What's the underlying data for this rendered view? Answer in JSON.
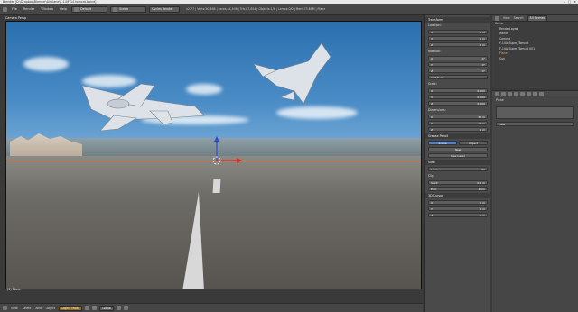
{
  "window": {
    "title": "Blender [D:\\Dropbox\\Blender\\Airplane\\F-14\\F-14 tomcat.blend]",
    "controls": [
      "–",
      "□",
      "×"
    ]
  },
  "infobar": {
    "menus": [
      "File",
      "Render",
      "Window",
      "Help"
    ],
    "layout": "Default",
    "scene": "Scene",
    "engine": "Cycles Render",
    "stats": "v2.77 | Verts:50,466 | Faces:44,946 | Tris:87,854 | Objects:1/6 | Lamps:0/0 | Mem:73.84M | Plane"
  },
  "viewport": {
    "header": "Camera Persp",
    "object": "(1) Plane",
    "colors": {
      "sky": "#4a8cc6",
      "horizon_line": "#c45a1e"
    }
  },
  "toolbar": {
    "menus": [
      "View",
      "Select",
      "Add",
      "Object"
    ],
    "mode": "Object Mode",
    "pivot": "Global"
  },
  "npanel": {
    "sections": [
      {
        "title": "Transform",
        "fields": []
      },
      {
        "title": "Location:",
        "fields": [
          [
            "X:",
            "0 m"
          ],
          [
            "Y:",
            "0 m"
          ],
          [
            "Z:",
            "0 m"
          ]
        ]
      },
      {
        "title": "Rotation:",
        "fields": [
          [
            "X:",
            "0°"
          ],
          [
            "Y:",
            "0°"
          ],
          [
            "Z:",
            "0°"
          ]
        ]
      },
      {
        "title": "XYZ Euler",
        "fields": []
      },
      {
        "title": "Scale:",
        "fields": [
          [
            "X:",
            "0.000"
          ],
          [
            "Y:",
            "0.000"
          ],
          [
            "Z:",
            "0.000"
          ]
        ]
      },
      {
        "title": "Dimensions:",
        "fields": [
          [
            "X:",
            "30 m"
          ],
          [
            "Y:",
            "18 m"
          ],
          [
            "Z:",
            "5 m"
          ]
        ]
      },
      {
        "title": "Grease Pencil",
        "fields": []
      },
      {
        "title": "View",
        "fields": [
          [
            "Lens:",
            "50"
          ]
        ]
      },
      {
        "title": "Clip:",
        "fields": [
          [
            "Start:",
            "0.1 m"
          ],
          [
            "End:",
            "1 km"
          ]
        ]
      },
      {
        "title": "3D Cursor",
        "fields": [
          [
            "X:",
            "0 m"
          ],
          [
            "Y:",
            "0 m"
          ],
          [
            "Z:",
            "0 m"
          ]
        ]
      }
    ],
    "buttons": {
      "scene": "Scene",
      "object": "Object",
      "new": "New",
      "new_layer": "New Layer"
    }
  },
  "outliner": {
    "tabs": [
      "View",
      "Search",
      "All Scenes"
    ],
    "items": [
      "Scene",
      "RenderLayers",
      "World",
      "Camera",
      "F-14A_Super_Tomcat",
      "F-14A_Super_Tomcat.001",
      "Plane",
      "Sun"
    ]
  },
  "properties": {
    "object": "Plane",
    "items": [
      "Plane",
      "View"
    ]
  }
}
